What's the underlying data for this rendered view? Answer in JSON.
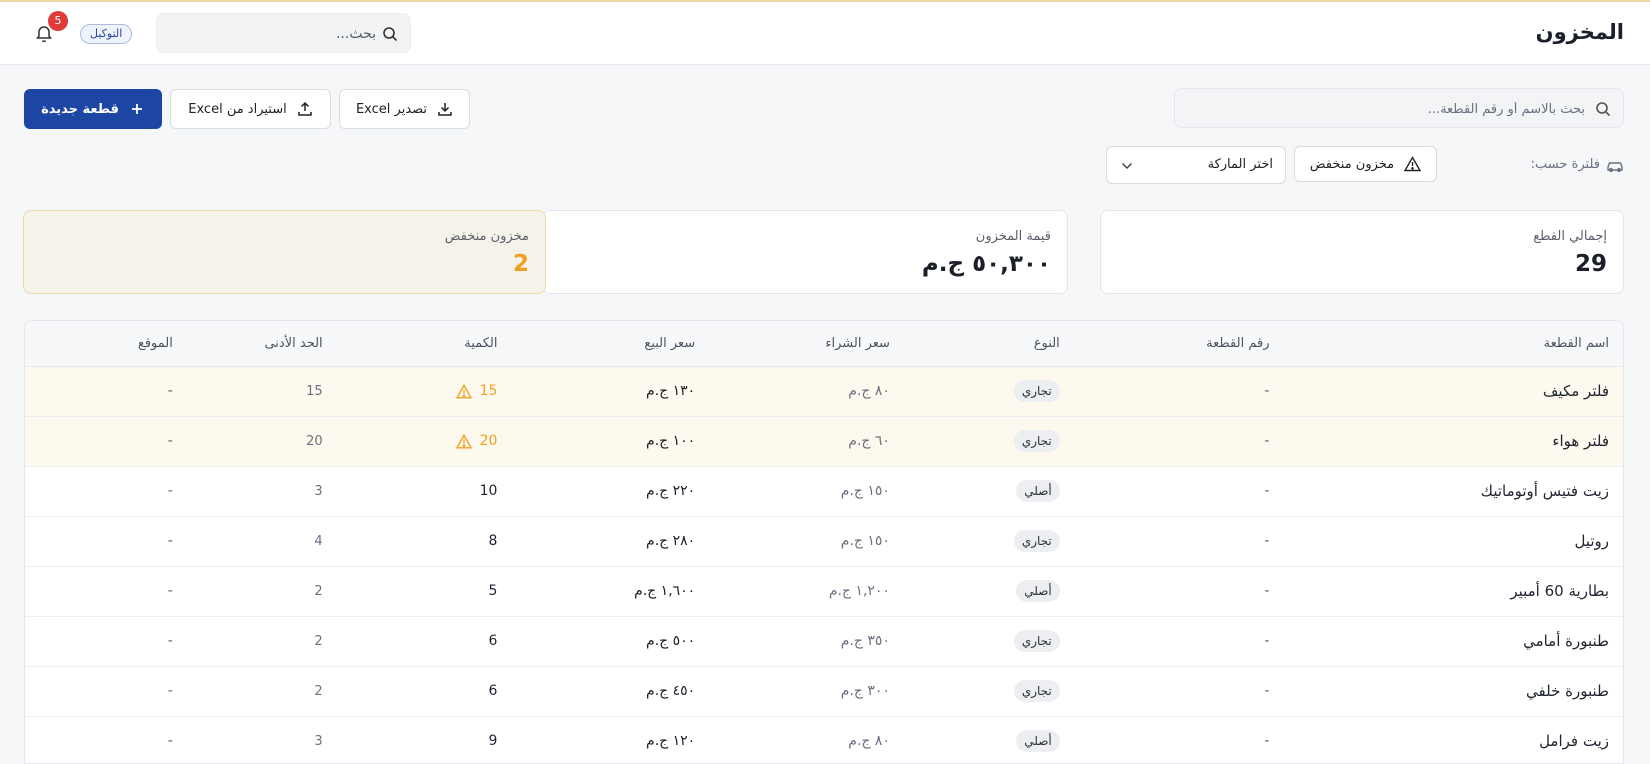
{
  "header": {
    "title": "المخزون",
    "search_placeholder": "بحث...",
    "badge": "التوكيل",
    "notifications_count": "5"
  },
  "toolbar": {
    "search_placeholder": "بحث بالاسم أو رقم القطعة...",
    "export_label": "تصدير Excel",
    "import_label": "استيراد من Excel",
    "new_label": "قطعة جديدة"
  },
  "filters": {
    "label": "فلترة حسب:",
    "low_stock_label": "مخزون منخفض",
    "brand_placeholder": "اختر الماركة"
  },
  "stats": {
    "total_label": "إجمالي القطع",
    "total_value": "29",
    "value_label": "قيمة المخزون",
    "value_value": "٥٠,٣٠٠ ج.م",
    "low_label": "مخزون منخفض",
    "low_value": "2"
  },
  "table": {
    "headers": {
      "name": "اسم القطعة",
      "code": "رقم القطعة",
      "type": "النوع",
      "buy": "سعر الشراء",
      "sell": "سعر البيع",
      "qty": "الكمية",
      "min": "الحد الأدنى",
      "loc": "الموقع"
    },
    "rows": [
      {
        "name": "فلتر مكيف",
        "code": "-",
        "type": "تجاري",
        "buy": "٨٠ ج.م",
        "sell": "١٣٠ ج.م",
        "qty": "15",
        "min": "15",
        "loc": "-",
        "low": true
      },
      {
        "name": "فلتر هواء",
        "code": "-",
        "type": "تجاري",
        "buy": "٦٠ ج.م",
        "sell": "١٠٠ ج.م",
        "qty": "20",
        "min": "20",
        "loc": "-",
        "low": true
      },
      {
        "name": "زيت فتيس أوتوماتيك",
        "code": "-",
        "type": "أصلي",
        "buy": "١٥٠ ج.م",
        "sell": "٢٢٠ ج.م",
        "qty": "10",
        "min": "3",
        "loc": "-",
        "low": false
      },
      {
        "name": "روتيل",
        "code": "-",
        "type": "تجاري",
        "buy": "١٥٠ ج.م",
        "sell": "٢٨٠ ج.م",
        "qty": "8",
        "min": "4",
        "loc": "-",
        "low": false
      },
      {
        "name": "بطارية 60 أمبير",
        "code": "-",
        "type": "أصلي",
        "buy": "١,٢٠٠ ج.م",
        "sell": "١,٦٠٠ ج.م",
        "qty": "5",
        "min": "2",
        "loc": "-",
        "low": false
      },
      {
        "name": "طنبورة أمامي",
        "code": "-",
        "type": "تجاري",
        "buy": "٣٥٠ ج.م",
        "sell": "٥٠٠ ج.م",
        "qty": "6",
        "min": "2",
        "loc": "-",
        "low": false
      },
      {
        "name": "طنبورة خلفي",
        "code": "-",
        "type": "تجاري",
        "buy": "٣٠٠ ج.م",
        "sell": "٤٥٠ ج.م",
        "qty": "6",
        "min": "2",
        "loc": "-",
        "low": false
      },
      {
        "name": "زيت فرامل",
        "code": "-",
        "type": "أصلي",
        "buy": "٨٠ ج.م",
        "sell": "١٢٠ ج.م",
        "qty": "9",
        "min": "3",
        "loc": "-",
        "low": false
      }
    ]
  },
  "colors": {
    "primary": "#1d45a3",
    "warning": "#f0a020",
    "badge_red": "#e03a3a"
  }
}
